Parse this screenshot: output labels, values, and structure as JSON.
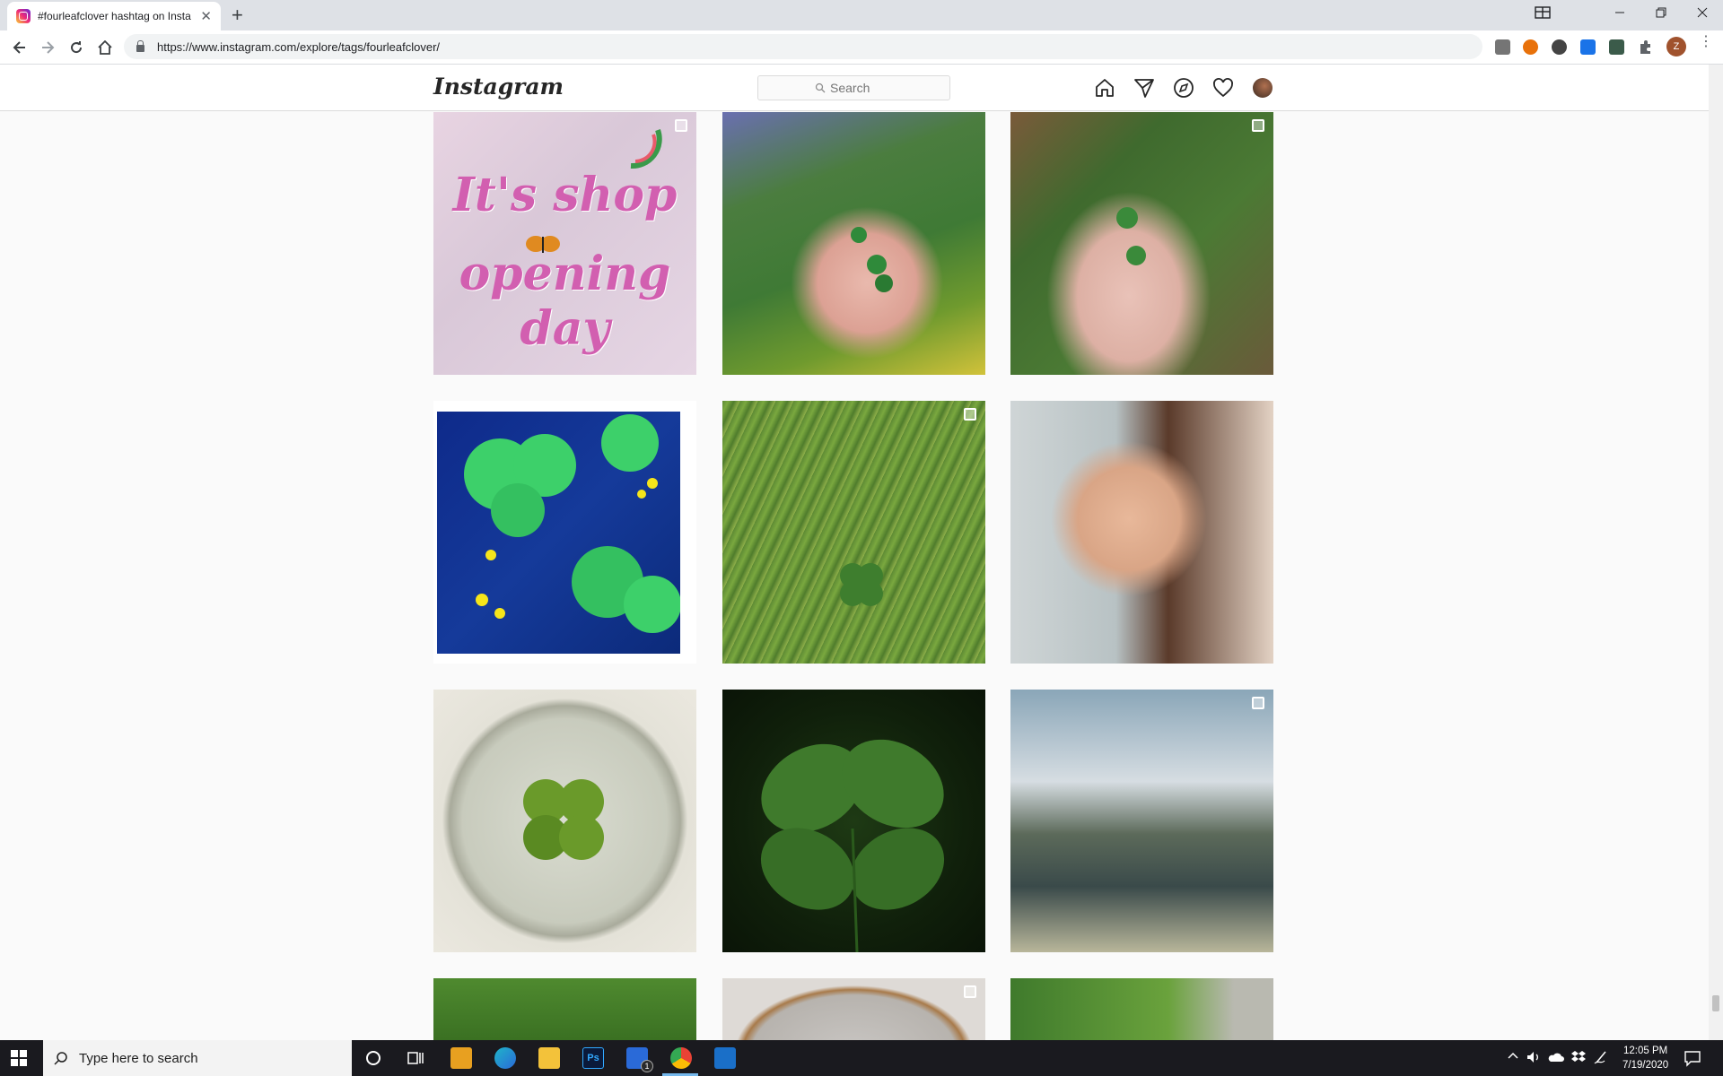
{
  "browser": {
    "tab_title": "#fourleafclover hashtag on Insta",
    "tab_close": "✕",
    "new_tab": "+",
    "url": "https://www.instagram.com/explore/tags/fourleafclover/",
    "profile_initial": "Z"
  },
  "instagram": {
    "logo": "Instagram",
    "search_placeholder": "Search"
  },
  "posts": [
    {
      "label_line1": "It's shop",
      "label_line2": "opening day",
      "multi": true
    },
    {
      "multi": false
    },
    {
      "multi": true
    },
    {
      "multi": false
    },
    {
      "multi": true
    },
    {
      "multi": false
    },
    {
      "multi": false
    },
    {
      "multi": false
    },
    {
      "multi": true
    },
    {
      "multi": false
    },
    {
      "multi": true
    },
    {
      "multi": false
    }
  ],
  "taskbar": {
    "search_placeholder": "Type here to search",
    "time": "12:05 PM",
    "date": "7/19/2020",
    "mail_badge": "1"
  },
  "colors": {
    "accent_pink": "#d25fb0",
    "header_border": "#dbdbdb",
    "page_bg": "#fafafa"
  }
}
